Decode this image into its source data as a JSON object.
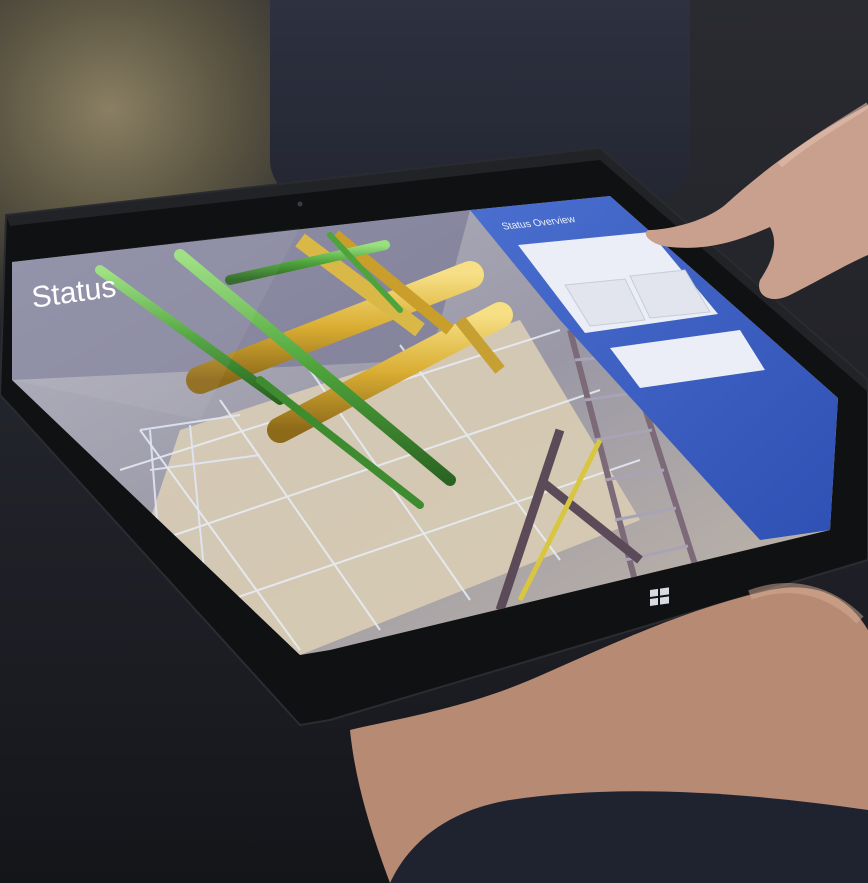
{
  "screen": {
    "title": "Status",
    "panel_heading": "Status Overview"
  },
  "colors": {
    "panel_blue": "#3f63c4",
    "pipe_yellow": "#e6c24a",
    "pipe_green": "#5cb34a",
    "tablet_bezel": "#111214"
  },
  "icons": {
    "windows_button": "windows-logo-icon"
  }
}
